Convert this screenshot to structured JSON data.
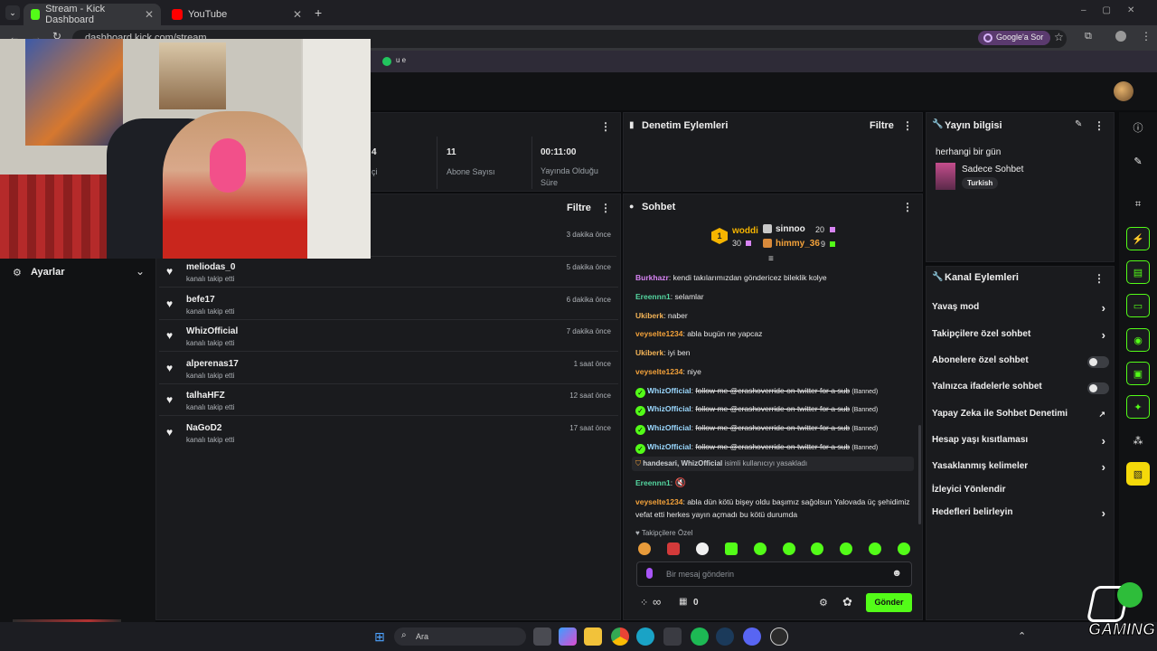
{
  "browser": {
    "tabs": [
      {
        "title": "Stream - Kick Dashboard",
        "active": true
      },
      {
        "title": "YouTube",
        "active": false
      }
    ],
    "url": "dashboard.kick.com/stream",
    "google_button": "Google'a Sor",
    "bookmark_label": "u e"
  },
  "stats": {
    "followers_count_partial": "4",
    "followers_label_partial": "çi",
    "subs_count": "11",
    "subs_label": "Abone Sayısı",
    "uptime": "00:11:00",
    "uptime_label_1": "Yayında Olduğu",
    "uptime_label_2": "Süre"
  },
  "sidebar": {
    "settings_label": "Ayarlar"
  },
  "activity": {
    "filter_label": "Filtre",
    "first_time": "3 dakika önce",
    "items": [
      {
        "name": "meliodas_0",
        "action": "kanalı takip etti",
        "time": "5 dakika önce"
      },
      {
        "name": "befe17",
        "action": "kanalı takip etti",
        "time": "6 dakika önce"
      },
      {
        "name": "WhizOfficial",
        "action": "kanalı takip etti",
        "time": "7 dakika önce"
      },
      {
        "name": "alperenas17",
        "action": "kanalı takip etti",
        "time": "1 saat önce"
      },
      {
        "name": "talhaHFZ",
        "action": "kanalı takip etti",
        "time": "12 saat önce"
      },
      {
        "name": "NaGoD2",
        "action": "kanalı takip etti",
        "time": "17 saat önce"
      }
    ]
  },
  "moderation": {
    "title": "Denetim Eylemleri",
    "filter_label": "Filtre"
  },
  "chat": {
    "title": "Sohbet",
    "top": {
      "first_name": "woddi",
      "first_count": "30",
      "second_name": "sinnoo",
      "second_count": "20",
      "third_name": "himmy_36",
      "third_count": "9"
    },
    "messages": [
      {
        "user": "Burkhazr",
        "color": "#d884f4",
        "text": "kendi takılarımızdan göndericez bileklik kolye"
      },
      {
        "user": "Ereennn1",
        "color": "#54d6a0",
        "text": "selamlar"
      },
      {
        "user": "Ukiberk",
        "color": "#f4b457",
        "text": "naber"
      },
      {
        "user": "veyselte1234",
        "color": "#f4a23a",
        "text": "abla bugün ne yapcaz"
      },
      {
        "user": "Ukiberk",
        "color": "#f4b457",
        "text": "iyi ben"
      },
      {
        "user": "veyselte1234",
        "color": "#f4a23a",
        "text": "niye"
      }
    ],
    "banned_messages": [
      {
        "user": "WhizOfficial",
        "text": "follow me @crashoverride on twitter for a sub",
        "tag": "(Banned)"
      },
      {
        "user": "WhizOfficial",
        "text": "follow me @crashoverride on twitter for a sub",
        "tag": "(Banned)"
      },
      {
        "user": "WhizOfficial",
        "text": "follow me @crashoverride on twitter for a sub",
        "tag": "(Banned)"
      },
      {
        "user": "WhizOfficial",
        "text": "follow me @crashoverride on twitter for a sub",
        "tag": "(Banned)"
      }
    ],
    "ban_notice_users": "handesari, WhizOfficial",
    "ban_notice_text": "isimli kullanıcıyı yasakladı",
    "after": [
      {
        "user": "Ereennn1",
        "color": "#54d6a0",
        "text": ""
      },
      {
        "user": "veyselte1234",
        "color": "#f4a23a",
        "text": "abla dün kötü bişey oldu başımız sağolsun Yalovada üç şehidimiz vefat etti herkes yayın açmadı bu kötü durumda"
      }
    ],
    "followers_only": "Takipçilere Özel",
    "input_placeholder": "Bir mesaj gönderin",
    "infinity": "∞",
    "zero": "0",
    "send_label": "Gönder"
  },
  "stream_info": {
    "title": "Yayın bilgisi",
    "stream_title": "herhangi bir gün",
    "category": "Sadece Sohbet",
    "language_tag": "Turkish"
  },
  "channel_actions": {
    "title": "Kanal Eylemleri",
    "rows": [
      {
        "label": "Yavaş mod",
        "kind": "arrow"
      },
      {
        "label": "Takipçilere özel sohbet",
        "kind": "arrow"
      },
      {
        "label": "Abonelere özel sohbet",
        "kind": "toggle"
      },
      {
        "label": "Yalnızca ifadelerle sohbet",
        "kind": "toggle"
      },
      {
        "label": "Yapay Zeka ile Sohbet Denetimi",
        "kind": "external"
      },
      {
        "label": "Hesap yaşı kısıtlaması",
        "kind": "arrow"
      },
      {
        "label": "Yasaklanmış kelimeler",
        "kind": "arrow"
      },
      {
        "label": "İzleyici Yönlendir",
        "kind": "none"
      },
      {
        "label": "Hedefleri belirleyin",
        "kind": "arrow"
      }
    ]
  },
  "taskbar": {
    "search_label": "Ara"
  },
  "overlay": {
    "brand": "GAMING"
  },
  "colors": {
    "kick_green": "#53fc18",
    "panel": "#1a1b1e",
    "bg": "#0b0c0e"
  }
}
